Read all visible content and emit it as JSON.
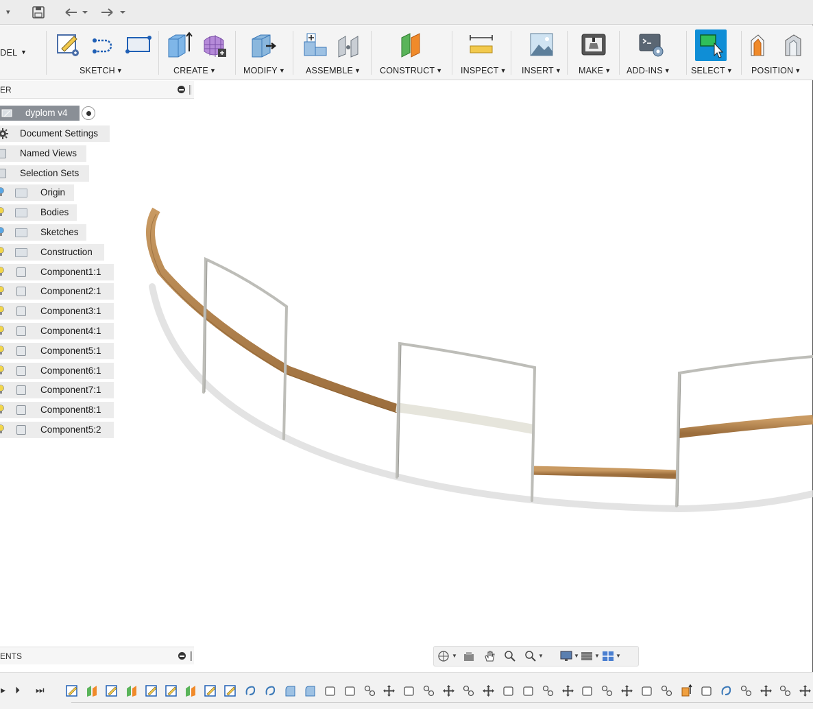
{
  "quick_access": {
    "menu_caret": "▾",
    "undo": "⤺",
    "redo": "⤻"
  },
  "toolbar": {
    "workspace_label": "DEL",
    "groups": [
      {
        "key": "sketch",
        "label": "SKETCH"
      },
      {
        "key": "create",
        "label": "CREATE"
      },
      {
        "key": "modify",
        "label": "MODIFY"
      },
      {
        "key": "assemble",
        "label": "ASSEMBLE"
      },
      {
        "key": "construct",
        "label": "CONSTRUCT"
      },
      {
        "key": "inspect",
        "label": "INSPECT"
      },
      {
        "key": "insert",
        "label": "INSERT"
      },
      {
        "key": "make",
        "label": "MAKE"
      },
      {
        "key": "addins",
        "label": "ADD-INS"
      },
      {
        "key": "select",
        "label": "SELECT"
      },
      {
        "key": "position",
        "label": "POSITION"
      }
    ],
    "select_accent": "#0f8ed6"
  },
  "browser": {
    "header_label": "ER",
    "root": "dyplom v4",
    "items": [
      {
        "label": "Document Settings",
        "icon": "gear-icon"
      },
      {
        "label": "Named Views",
        "icon": "folder-icon"
      },
      {
        "label": "Selection Sets",
        "icon": "folder-icon"
      },
      {
        "label": "Origin",
        "icon": "folder-icon"
      },
      {
        "label": "Bodies",
        "icon": "folder-icon"
      },
      {
        "label": "Sketches",
        "icon": "folder-icon"
      },
      {
        "label": "Construction",
        "icon": "folder-icon"
      },
      {
        "label": "Component1:1",
        "icon": "component-icon"
      },
      {
        "label": "Component2:1",
        "icon": "component-icon"
      },
      {
        "label": "Component3:1",
        "icon": "component-icon"
      },
      {
        "label": "Component4:1",
        "icon": "component-icon"
      },
      {
        "label": "Component5:1",
        "icon": "component-icon"
      },
      {
        "label": "Component6:1",
        "icon": "component-icon"
      },
      {
        "label": "Component7:1",
        "icon": "component-icon"
      },
      {
        "label": "Component8:1",
        "icon": "component-icon"
      },
      {
        "label": "Component5:2",
        "icon": "component-icon"
      }
    ]
  },
  "comments": {
    "header_label": "ENTS"
  },
  "colors": {
    "wood": "#a97a45",
    "wood_light": "#c99a62",
    "metal": "#c9c9c4",
    "bulb_yellow": "#f2d64b",
    "bulb_blue": "#5aa7e6"
  }
}
